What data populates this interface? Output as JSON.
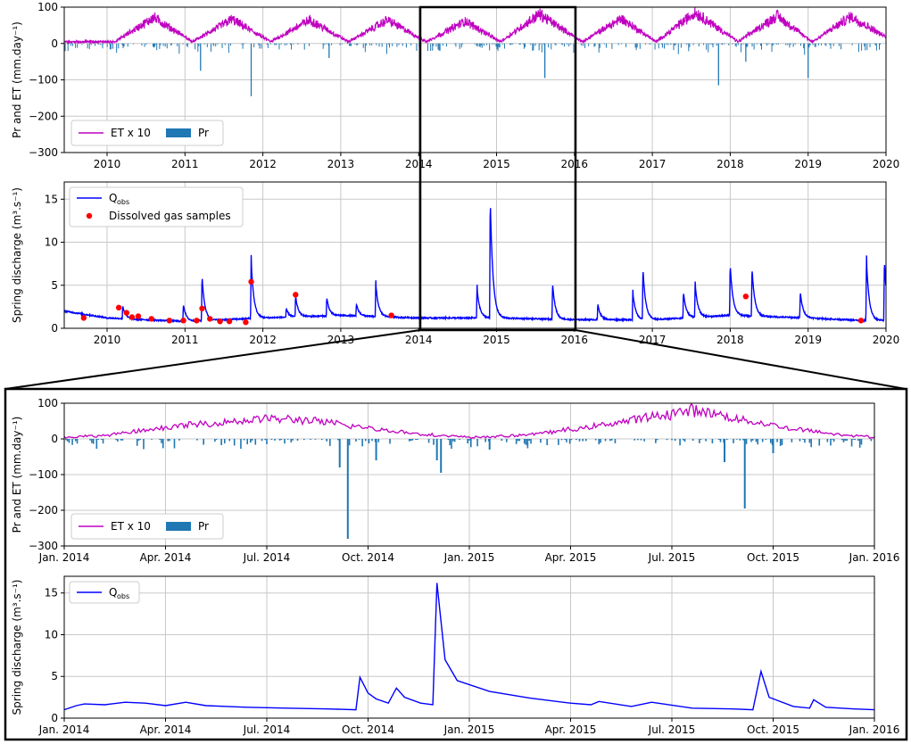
{
  "chart_data": [
    {
      "id": "overview-precip-et",
      "type": "bar+line",
      "ylabel": "Pr and ET (mm.day⁻¹)",
      "ylim": [
        -300,
        100
      ],
      "yticks": [
        "100",
        "0",
        "−100",
        "−200",
        "−300"
      ],
      "xlim": [
        2009.45,
        2020.0
      ],
      "xticks": [
        "2010",
        "2011",
        "2012",
        "2013",
        "2014",
        "2015",
        "2016",
        "2017",
        "2018",
        "2019",
        "2020"
      ],
      "grid": true,
      "legend": {
        "placement": "lower-left",
        "entries": [
          "ET x 10",
          "Pr"
        ]
      },
      "series": [
        {
          "name": "ET x 10",
          "kind": "line",
          "color": "#c000c0",
          "description": "seasonal cycle, ~0–10 in winter, peaks ~60–90 in summer",
          "summer_peaks": [
            [
              2010.6,
              75
            ],
            [
              2011.6,
              70
            ],
            [
              2012.6,
              68
            ],
            [
              2013.6,
              68
            ],
            [
              2014.6,
              65
            ],
            [
              2015.55,
              85
            ],
            [
              2016.6,
              72
            ],
            [
              2017.55,
              90
            ],
            [
              2018.6,
              80
            ],
            [
              2019.55,
              78
            ]
          ]
        },
        {
          "name": "Pr",
          "kind": "bar",
          "color": "#1f77b4",
          "notable_values": [
            [
              2011.2,
              -75
            ],
            [
              2011.85,
              -145
            ],
            [
              2015.62,
              -95
            ],
            [
              2017.85,
              -115
            ],
            [
              2019.0,
              -95
            ],
            [
              2018.2,
              -50
            ],
            [
              2012.85,
              -40
            ]
          ]
        }
      ]
    },
    {
      "id": "overview-discharge",
      "type": "line+scatter",
      "ylabel": "Spring discharge (m³.s⁻¹)",
      "ylim": [
        0,
        17
      ],
      "yticks": [
        "0",
        "5",
        "10",
        "15"
      ],
      "xlim": [
        2009.45,
        2020.0
      ],
      "xticks": [
        "2010",
        "2011",
        "2012",
        "2013",
        "2014",
        "2015",
        "2016",
        "2017",
        "2018",
        "2019",
        "2020"
      ],
      "grid": true,
      "legend": {
        "placement": "upper-left",
        "entries": [
          "Q",
          "obs",
          "Dissolved gas samples"
        ]
      },
      "series": [
        {
          "name": "Qobs",
          "kind": "line",
          "color": "#0000ff",
          "peaks": [
            [
              2010.2,
              2.8
            ],
            [
              2010.98,
              3.0
            ],
            [
              2011.22,
              6.5
            ],
            [
              2011.85,
              8.5
            ],
            [
              2012.3,
              2.4
            ],
            [
              2012.42,
              4.0
            ],
            [
              2012.82,
              3.8
            ],
            [
              2013.2,
              3.0
            ],
            [
              2013.45,
              5.5
            ],
            [
              2014.75,
              5.0
            ],
            [
              2014.92,
              16.2
            ],
            [
              2015.72,
              5.6
            ],
            [
              2016.3,
              3.0
            ],
            [
              2016.75,
              4.5
            ],
            [
              2016.88,
              7.5
            ],
            [
              2017.4,
              4.5
            ],
            [
              2017.55,
              5.5
            ],
            [
              2018.0,
              8.0
            ],
            [
              2018.28,
              7.5
            ],
            [
              2018.9,
              4.5
            ],
            [
              2019.75,
              8.5
            ],
            [
              2019.98,
              8.5
            ]
          ],
          "baseflow": [
            [
              2009.45,
              2.0
            ],
            [
              2010.0,
              1.2
            ],
            [
              2011.0,
              0.8
            ],
            [
              2012.0,
              1.2
            ],
            [
              2013.0,
              1.5
            ],
            [
              2014.0,
              1.2
            ],
            [
              2015.0,
              1.2
            ],
            [
              2016.0,
              1.0
            ],
            [
              2017.0,
              1.0
            ],
            [
              2018.0,
              1.5
            ],
            [
              2019.0,
              1.2
            ],
            [
              2019.7,
              0.9
            ]
          ]
        },
        {
          "name": "Dissolved gas samples",
          "kind": "scatter",
          "color": "#ff0000",
          "points": [
            [
              2009.7,
              1.2
            ],
            [
              2010.15,
              2.4
            ],
            [
              2010.25,
              1.8
            ],
            [
              2010.32,
              1.3
            ],
            [
              2010.4,
              1.4
            ],
            [
              2010.57,
              1.1
            ],
            [
              2010.8,
              0.9
            ],
            [
              2010.98,
              0.9
            ],
            [
              2011.15,
              0.9
            ],
            [
              2011.22,
              2.3
            ],
            [
              2011.32,
              1.1
            ],
            [
              2011.45,
              0.8
            ],
            [
              2011.57,
              0.8
            ],
            [
              2011.78,
              0.7
            ],
            [
              2011.85,
              5.4
            ],
            [
              2012.42,
              3.9
            ],
            [
              2013.65,
              1.5
            ],
            [
              2018.2,
              3.7
            ],
            [
              2019.68,
              0.9
            ]
          ]
        }
      ]
    },
    {
      "id": "zoom-precip-et",
      "type": "bar+line",
      "ylabel": "Pr and ET (mm.day⁻¹)",
      "ylim": [
        -300,
        100
      ],
      "yticks": [
        "100",
        "0",
        "−100",
        "−200",
        "−300"
      ],
      "xlim": [
        2014.0,
        2016.0
      ],
      "xticks": [
        "Jan. 2014",
        "Apr. 2014",
        "Jul. 2014",
        "Oct. 2014",
        "Jan. 2015",
        "Apr. 2015",
        "Jul. 2015",
        "Oct. 2015",
        "Jan. 2016"
      ],
      "grid": true,
      "legend": {
        "placement": "lower-left",
        "entries": [
          "ET x 10",
          "Pr"
        ]
      },
      "series": [
        {
          "name": "ET x 10",
          "kind": "line",
          "color": "#c000c0",
          "points": [
            [
              2014.0,
              5
            ],
            [
              2014.1,
              10
            ],
            [
              2014.2,
              25
            ],
            [
              2014.3,
              40
            ],
            [
              2014.4,
              50
            ],
            [
              2014.5,
              60
            ],
            [
              2014.6,
              55
            ],
            [
              2014.7,
              40
            ],
            [
              2014.8,
              25
            ],
            [
              2014.9,
              12
            ],
            [
              2015.0,
              5
            ],
            [
              2015.1,
              8
            ],
            [
              2015.2,
              20
            ],
            [
              2015.3,
              35
            ],
            [
              2015.4,
              55
            ],
            [
              2015.5,
              75
            ],
            [
              2015.55,
              85
            ],
            [
              2015.6,
              75
            ],
            [
              2015.7,
              50
            ],
            [
              2015.8,
              30
            ],
            [
              2015.9,
              15
            ],
            [
              2016.0,
              5
            ]
          ]
        },
        {
          "name": "Pr",
          "kind": "bar",
          "color": "#1f77b4",
          "notable_values": [
            [
              2014.7,
              -280
            ],
            [
              2014.68,
              -80
            ],
            [
              2014.77,
              -60
            ],
            [
              2014.93,
              -95
            ],
            [
              2014.92,
              -60
            ],
            [
              2015.05,
              -30
            ],
            [
              2015.63,
              -65
            ],
            [
              2015.68,
              -195
            ],
            [
              2015.75,
              -40
            ]
          ]
        }
      ]
    },
    {
      "id": "zoom-discharge",
      "type": "line",
      "ylabel": "Spring discharge (m³.s⁻¹)",
      "ylim": [
        0,
        17
      ],
      "yticks": [
        "0",
        "5",
        "10",
        "15"
      ],
      "xlim": [
        2014.0,
        2016.0
      ],
      "xticks": [
        "Jan. 2014",
        "Apr. 2014",
        "Jul. 2014",
        "Oct. 2014",
        "Jan. 2015",
        "Apr. 2015",
        "Jul. 2015",
        "Oct. 2015",
        "Jan. 2016"
      ],
      "grid": true,
      "legend": {
        "placement": "upper-left",
        "entries": [
          "Q",
          "obs"
        ]
      },
      "series": [
        {
          "name": "Qobs",
          "kind": "line",
          "color": "#0000ff",
          "points": [
            [
              2014.0,
              1.0
            ],
            [
              2014.03,
              1.5
            ],
            [
              2014.05,
              1.7
            ],
            [
              2014.1,
              1.6
            ],
            [
              2014.15,
              1.9
            ],
            [
              2014.2,
              1.8
            ],
            [
              2014.25,
              1.5
            ],
            [
              2014.3,
              1.9
            ],
            [
              2014.35,
              1.5
            ],
            [
              2014.45,
              1.3
            ],
            [
              2014.55,
              1.2
            ],
            [
              2014.65,
              1.1
            ],
            [
              2014.72,
              1.0
            ],
            [
              2014.73,
              4.9
            ],
            [
              2014.75,
              3.0
            ],
            [
              2014.77,
              2.3
            ],
            [
              2014.8,
              1.8
            ],
            [
              2014.82,
              3.6
            ],
            [
              2014.84,
              2.5
            ],
            [
              2014.88,
              1.8
            ],
            [
              2014.91,
              1.6
            ],
            [
              2014.92,
              16.2
            ],
            [
              2014.94,
              7.0
            ],
            [
              2014.97,
              4.5
            ],
            [
              2015.05,
              3.2
            ],
            [
              2015.15,
              2.4
            ],
            [
              2015.25,
              1.8
            ],
            [
              2015.3,
              1.6
            ],
            [
              2015.32,
              2.0
            ],
            [
              2015.4,
              1.4
            ],
            [
              2015.45,
              1.9
            ],
            [
              2015.55,
              1.2
            ],
            [
              2015.65,
              1.1
            ],
            [
              2015.7,
              1.0
            ],
            [
              2015.72,
              5.6
            ],
            [
              2015.74,
              2.5
            ],
            [
              2015.8,
              1.4
            ],
            [
              2015.84,
              1.2
            ],
            [
              2015.85,
              2.2
            ],
            [
              2015.88,
              1.3
            ],
            [
              2015.95,
              1.1
            ],
            [
              2016.0,
              1.0
            ]
          ]
        }
      ]
    }
  ]
}
